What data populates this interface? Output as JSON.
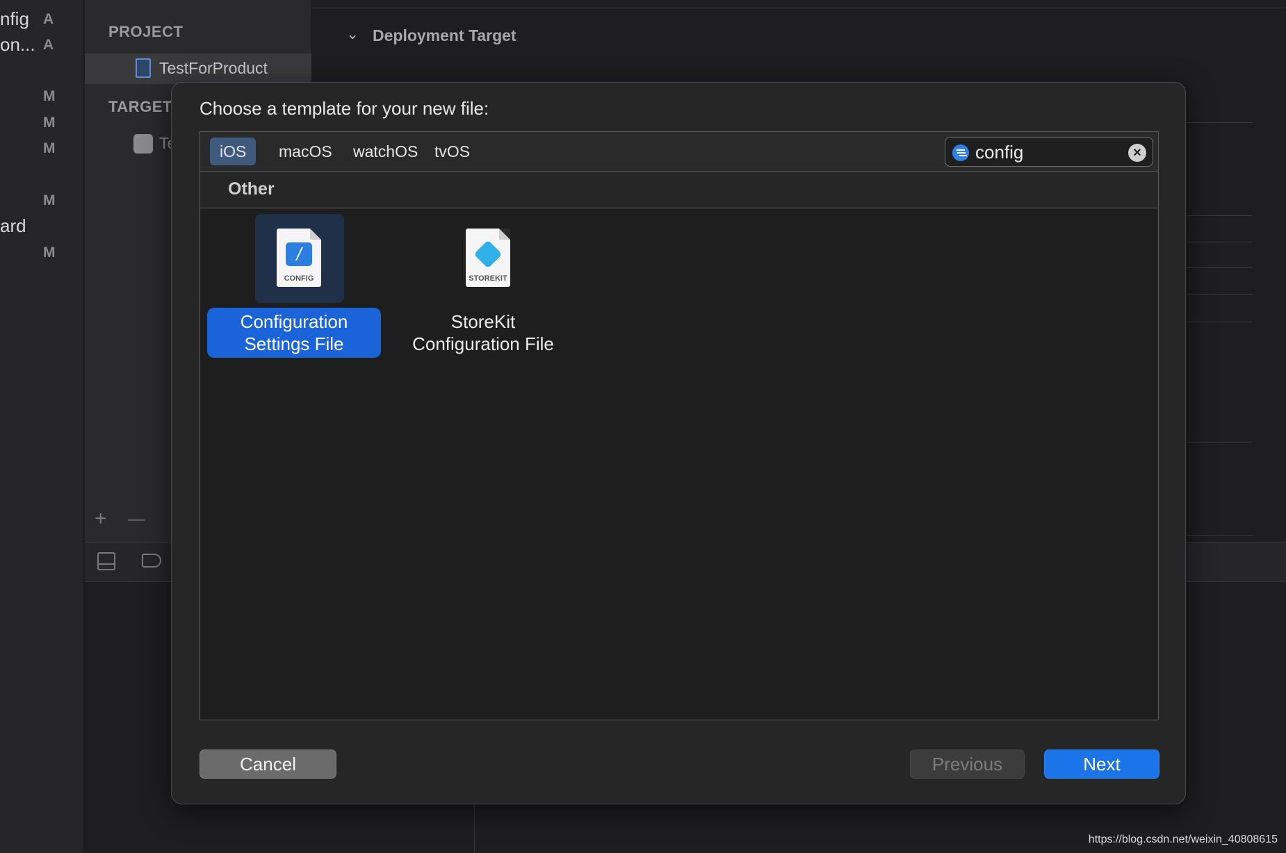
{
  "background": {
    "left_strip": [
      {
        "text": "nfig",
        "badge": "A"
      },
      {
        "text": "on...",
        "badge": "A"
      },
      {
        "text": "",
        "badge": "M"
      },
      {
        "text": "",
        "badge": "M"
      },
      {
        "text": "",
        "badge": "M"
      },
      {
        "text": "",
        "badge": "M"
      },
      {
        "text": "ard",
        "badge": ""
      },
      {
        "text": "",
        "badge": "M"
      }
    ],
    "project_header": "PROJECT",
    "project_name": "TestForProduct",
    "targets_header": "TARGET",
    "target_name": "Te",
    "deployment_section": "Deployment Target",
    "add_glyph": "+",
    "remove_glyph": "—",
    "watermark": "https://blog.csdn.net/weixin_40808615"
  },
  "dialog": {
    "title": "Choose a template for your new file:",
    "platform_tabs": [
      {
        "label": "iOS",
        "active": true
      },
      {
        "label": "macOS",
        "active": false
      },
      {
        "label": "watchOS",
        "active": false
      },
      {
        "label": "tvOS",
        "active": false
      }
    ],
    "search": {
      "value": "config",
      "placeholder": "Filter",
      "clear_icon": "clear-icon",
      "filter_icon": "filter-icon"
    },
    "section": "Other",
    "templates": [
      {
        "label": "Configuration Settings File",
        "icon_caption": "CONFIG",
        "icon": "config-file-icon",
        "selected": true
      },
      {
        "label": "StoreKit Configuration File",
        "icon_caption": "STOREKIT",
        "icon": "storekit-file-icon",
        "selected": false
      }
    ],
    "buttons": {
      "cancel": "Cancel",
      "previous": "Previous",
      "next": "Next"
    },
    "accent_color": "#1a63d8"
  }
}
